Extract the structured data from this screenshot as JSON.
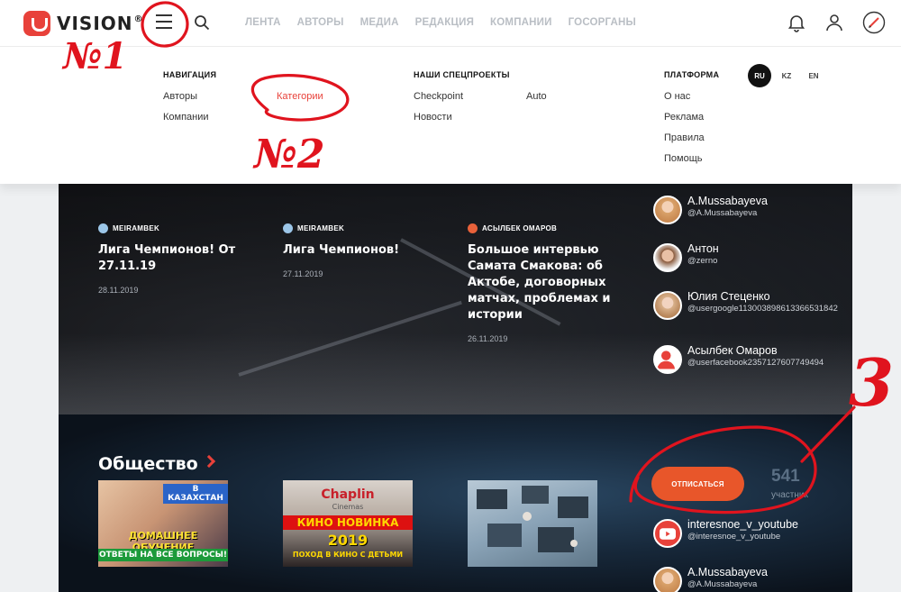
{
  "header": {
    "logo_text": "VISION",
    "logo_reg": "®",
    "nav": [
      "ЛЕНТА",
      "АВТОРЫ",
      "МЕДИА",
      "РЕДАКЦИЯ",
      "КОМПАНИИ",
      "ГОСОРГАНЫ"
    ]
  },
  "menu": {
    "nav_heading": "НАВИГАЦИЯ",
    "nav_items": [
      "Авторы",
      "Компании",
      "Категории"
    ],
    "special_heading": "НАШИ СПЕЦПРОЕКТЫ",
    "special_items": [
      "Checkpoint",
      "Новости",
      "Auto"
    ],
    "platform_heading": "ПЛАТФОРМА",
    "platform_items": [
      "О нас",
      "Реклама",
      "Правила",
      "Помощь"
    ],
    "languages": [
      "RU",
      "KZ",
      "EN"
    ],
    "active_language": "RU"
  },
  "hero": {
    "cards": [
      {
        "author": "MEIRAMBEK",
        "title": "Лига Чемпионов! От 27.11.19",
        "date": "28.11.2019"
      },
      {
        "author": "MEIRAMBEK",
        "title": "Лига Чемпионов!",
        "date": "27.11.2019"
      },
      {
        "author": "АСЫЛБЕК ОМАРОВ",
        "title": "Большое интервью Самата Смакова: об Актобе, договорных матчах, проблемах и истории",
        "date": "26.11.2019"
      }
    ],
    "users": [
      {
        "name": "A.Mussabayeva",
        "handle": "@A.Mussabayeva"
      },
      {
        "name": "Антон",
        "handle": "@zerno"
      },
      {
        "name": "Юлия Стеценко",
        "handle": "@usergoogle113003898613366531842"
      },
      {
        "name": "Асылбек Омаров",
        "handle": "@userfacebook2357127607749494"
      }
    ]
  },
  "society": {
    "title": "Общество",
    "thumb1_top": "В КАЗАХСТАН",
    "thumb1_mid": "ДОМАШНЕЕ ОБУЧЕНИЕ",
    "thumb1_bottom": "ОТВЕТЫ НА ВСЕ ВОПРОСЫ!",
    "thumb2_brand": "Chaplin",
    "thumb2_sub": "Cinemas",
    "thumb2_headline": "КИНО НОВИНКА",
    "thumb2_year": "2019",
    "thumb2_footer": "ПОХОД В КИНО С ДЕТЬМИ",
    "unsubscribe_label": "ОТПИСАТЬСЯ",
    "member_count": "541",
    "member_label": "участник",
    "members": [
      {
        "name": "interesnoe_v_youtube",
        "handle": "@interesnoe_v_youtube"
      },
      {
        "name": "A.Mussabayeva",
        "handle": "@A.Mussabayeva"
      }
    ]
  },
  "annotations": {
    "mark1": "№1",
    "mark2": "№2",
    "mark3": "3"
  },
  "colors": {
    "accent": "#e8413a",
    "button": "#e8562a",
    "annotation": "#e0141e"
  },
  "icons": [
    "logo-icon",
    "menu-icon",
    "search-icon",
    "bell-icon",
    "user-icon",
    "pen-icon",
    "chevron-right-icon",
    "youtube-icon"
  ]
}
